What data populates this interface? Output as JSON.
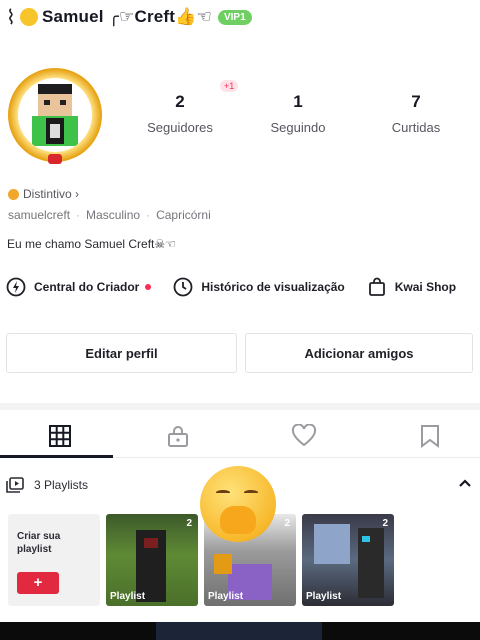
{
  "header": {
    "back_glyph": "⌇",
    "username": "Samuel ╭☞Creft👍☜",
    "vip_label": "VIP1"
  },
  "stats": [
    {
      "value": "2",
      "label": "Seguidores"
    },
    {
      "value": "1",
      "label": "Seguindo"
    },
    {
      "value": "7",
      "label": "Curtidas"
    }
  ],
  "stats_badge": "+1",
  "profile": {
    "badge": "Distintivo ›",
    "handle": "samuelcreft",
    "gender": "Masculino",
    "sign": "Capricórni",
    "bio": "Eu me chamo Samuel Creft☠☜"
  },
  "links": [
    {
      "label": "Central do Criador",
      "icon": "bulb-icon"
    },
    {
      "label": "Histórico de visualização",
      "icon": "clock-icon"
    },
    {
      "label": "Kwai Shop",
      "icon": "bag-icon"
    }
  ],
  "buttons": {
    "edit": "Editar perfil",
    "add": "Adicionar amigos"
  },
  "tabs": [
    {
      "icon": "grid-icon",
      "active": true
    },
    {
      "icon": "lock-icon",
      "active": false
    },
    {
      "icon": "heart-icon",
      "active": false
    },
    {
      "icon": "bookmark-icon",
      "active": false
    }
  ],
  "playlists": {
    "header": "3 Playlists",
    "create_label": "Criar sua playlist",
    "create_button": "+",
    "items": [
      {
        "label": "Playlist",
        "count": "2"
      },
      {
        "label": "Playlist",
        "count": "2"
      },
      {
        "label": "Playlist",
        "count": "2"
      }
    ]
  },
  "colors": {
    "accent": "#fe2c55",
    "vip": "#6fcf62",
    "create_button": "#e1293f"
  }
}
